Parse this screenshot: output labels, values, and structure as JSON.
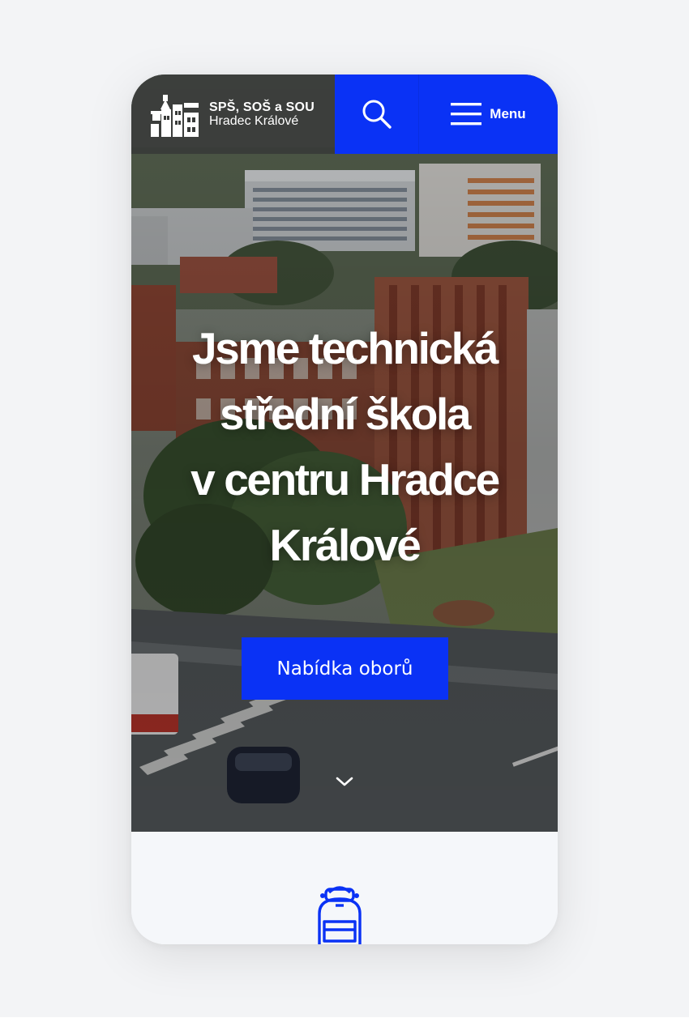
{
  "header": {
    "logo_line1": "SPŠ, SOŠ a SOU",
    "logo_line2": "Hradec Králové",
    "menu_label": "Menu",
    "accent_color": "#0a32f5"
  },
  "hero": {
    "headline_lines": [
      "Jsme technická",
      "střední škola",
      "v centru Hradce",
      "Králové"
    ],
    "cta_label": "Nabídka oborů"
  },
  "icons": {
    "logo": "school-buildings-logo-icon",
    "search": "search-icon",
    "menu": "hamburger-menu-icon",
    "scroll": "chevron-down-icon",
    "section": "backpack-icon"
  }
}
